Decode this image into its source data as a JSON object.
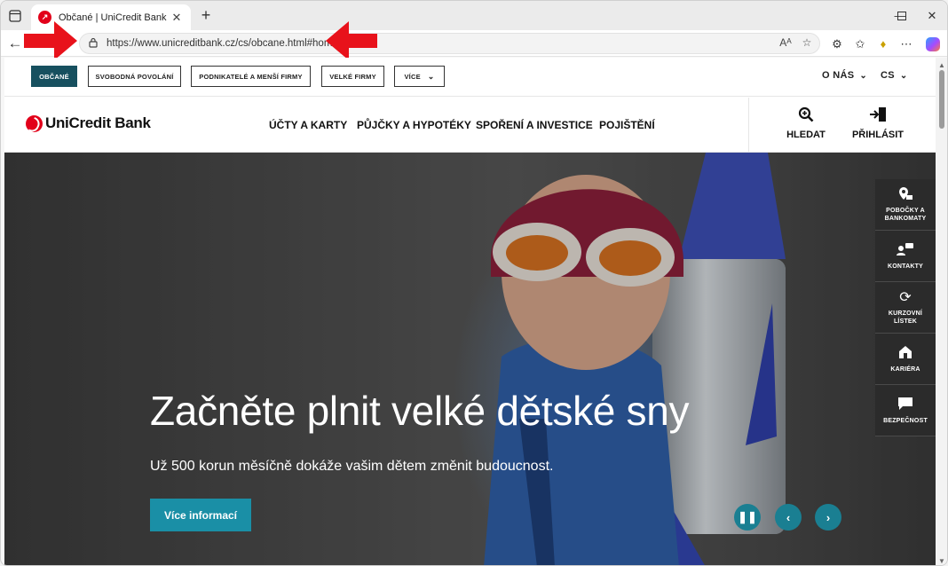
{
  "browser": {
    "tab_title": "Občané | UniCredit Bank",
    "url": "https://www.unicreditbank.cz/cs/obcane.html#home"
  },
  "segments": [
    {
      "label": "OBČANÉ",
      "active": true
    },
    {
      "label": "SVOBODNÁ POVOLÁNÍ",
      "active": false
    },
    {
      "label": "PODNIKATELÉ A MENŠÍ FIRMY",
      "active": false
    },
    {
      "label": "VELKÉ FIRMY",
      "active": false
    },
    {
      "label": "VÍCE",
      "active": false
    }
  ],
  "top_right": {
    "about": "O NÁS",
    "language": "CS"
  },
  "brand": {
    "logo_text": "UniCredit Bank",
    "color": "#e2001a"
  },
  "main_nav": [
    {
      "label": "ÚČTY A KARTY"
    },
    {
      "label": "PŮJČKY A HYPOTÉKY"
    },
    {
      "label": "SPOŘENÍ A INVESTICE"
    },
    {
      "label": "POJIŠTĚNÍ"
    }
  ],
  "header_actions": {
    "search": "HLEDAT",
    "login": "PŘIHLÁSIT"
  },
  "hero": {
    "title": "Začněte plnit velké dětské sny",
    "subtitle": "Už 500 korun měsíčně dokáže vašim dětem změnit budoucnost.",
    "cta": "Více informací"
  },
  "side_menu": [
    {
      "label": "POBOČKY A\nBANKOMATY",
      "icon": "map-pin-icon"
    },
    {
      "label": "KONTAKTY",
      "icon": "contacts-icon"
    },
    {
      "label": "KURZOVNÍ\nLÍSTEK",
      "icon": "exchange-icon"
    },
    {
      "label": "KARIÉRA",
      "icon": "home-icon"
    },
    {
      "label": "BEZPEČNOST",
      "icon": "chat-icon"
    }
  ],
  "colors": {
    "accent": "#17505f",
    "cta": "#1a8fa6",
    "annotation_arrow": "#e8121b"
  }
}
